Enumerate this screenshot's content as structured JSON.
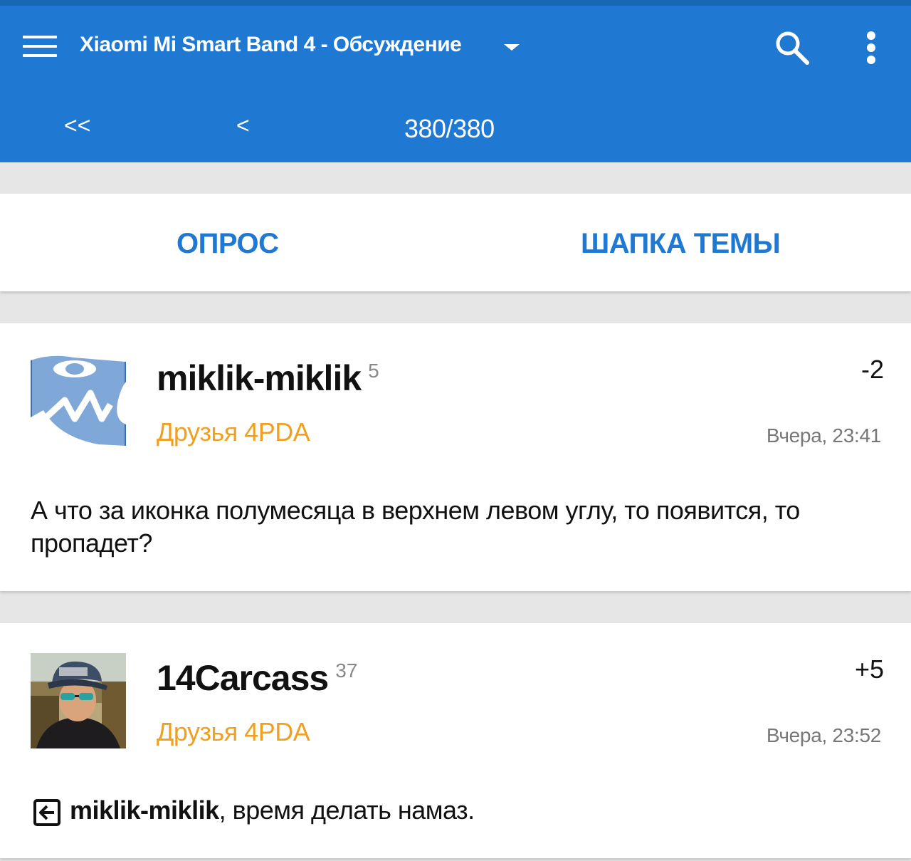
{
  "app_bar": {
    "title": "Xiaomi Mi Smart Band 4 - Обсуждение",
    "color": "#1f78d1",
    "icons": [
      "menu-icon",
      "dropdown-icon",
      "search-icon",
      "more-icon"
    ]
  },
  "pagination": {
    "first_label": "<<",
    "prev_label": "<",
    "counter": "380/380"
  },
  "tabs": {
    "poll": "ОПРОС",
    "topic_header": "ШАПКА ТЕМЫ"
  },
  "posts": [
    {
      "author": "miklik-miklik",
      "post_count": "5",
      "group": "Друзья 4PDA",
      "rating": "-2",
      "time": "Вчера, 23:41",
      "text": "А что за иконка полумесяца в верхнем левом углу, то появится, то пропадет?"
    },
    {
      "author": "14Carcass",
      "post_count": "37",
      "group": "Друзья 4PDA",
      "rating": "+5",
      "time": "Вчера, 23:52",
      "reply_to": "miklik-miklik",
      "text": ", время делать намаз."
    }
  ],
  "colors": {
    "accent": "#1f78d1",
    "group": "#f0a020"
  }
}
